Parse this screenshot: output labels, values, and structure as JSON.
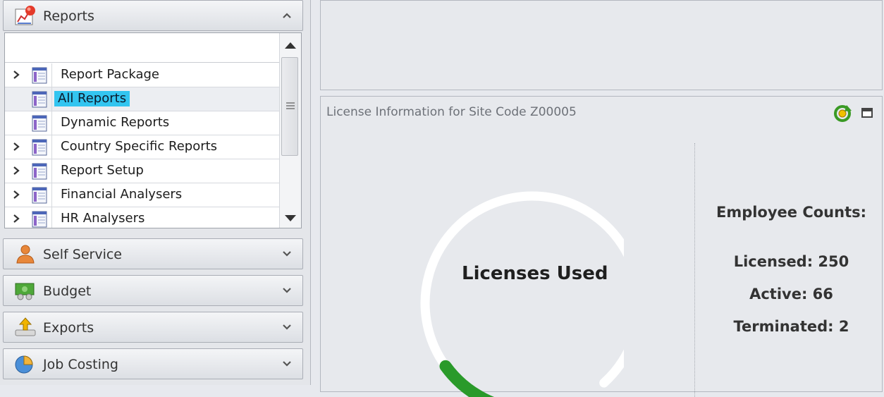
{
  "nav": {
    "reports": {
      "label": "Reports",
      "filter_value": "",
      "items": [
        {
          "label": "Report Package",
          "expandable": true,
          "selected": false
        },
        {
          "label": "All Reports",
          "expandable": false,
          "selected": true
        },
        {
          "label": "Dynamic Reports",
          "expandable": false,
          "selected": false
        },
        {
          "label": "Country Specific Reports",
          "expandable": true,
          "selected": false
        },
        {
          "label": "Report Setup",
          "expandable": true,
          "selected": false
        },
        {
          "label": "Financial Analysers",
          "expandable": true,
          "selected": false
        },
        {
          "label": "HR Analysers",
          "expandable": true,
          "selected": false
        }
      ]
    },
    "groups": [
      {
        "label": "Self Service",
        "icon": "self-service-icon"
      },
      {
        "label": "Budget",
        "icon": "budget-icon"
      },
      {
        "label": "Exports",
        "icon": "exports-icon"
      },
      {
        "label": "Job Costing",
        "icon": "job-costing-icon"
      }
    ]
  },
  "license": {
    "title": "License Information for Site Code Z00005",
    "gauge_label": "Licenses Used",
    "gauge_fraction": 0.264,
    "gauge_color": "#2a9a2a",
    "counts_heading": "Employee Counts:",
    "licensed": "Licensed: 250",
    "active": "Active: 66",
    "terminated": "Terminated: 2"
  },
  "colors": {
    "selection": "#33c5f0",
    "refresh": "#3a9a25"
  }
}
